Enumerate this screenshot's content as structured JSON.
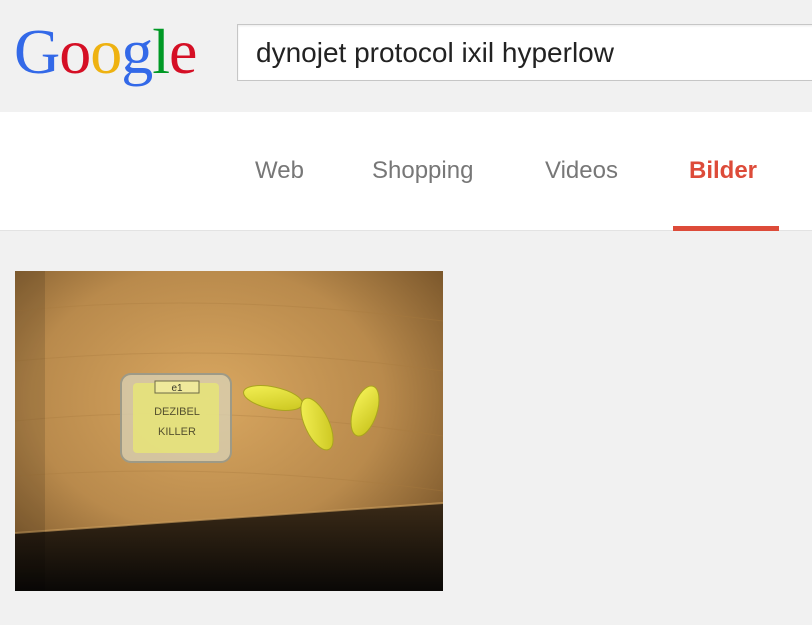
{
  "logo": {
    "letters": [
      "G",
      "o",
      "o",
      "g",
      "l",
      "e"
    ],
    "colors": [
      "#3369e8",
      "#d50f25",
      "#eeb211",
      "#3369e8",
      "#009925",
      "#d50f25"
    ]
  },
  "search": {
    "value": "dynojet protocol ixil hyperlow"
  },
  "tabs": [
    {
      "label": "Web",
      "active": false
    },
    {
      "label": "Shopping",
      "active": false
    },
    {
      "label": "Videos",
      "active": false
    },
    {
      "label": "Bilder",
      "active": true
    }
  ],
  "accent_color": "#dd4b39",
  "result": {
    "image_description_icon": "earplugs-photo",
    "box_text": [
      "e1",
      "DEZIBEL",
      "KILLER"
    ]
  }
}
